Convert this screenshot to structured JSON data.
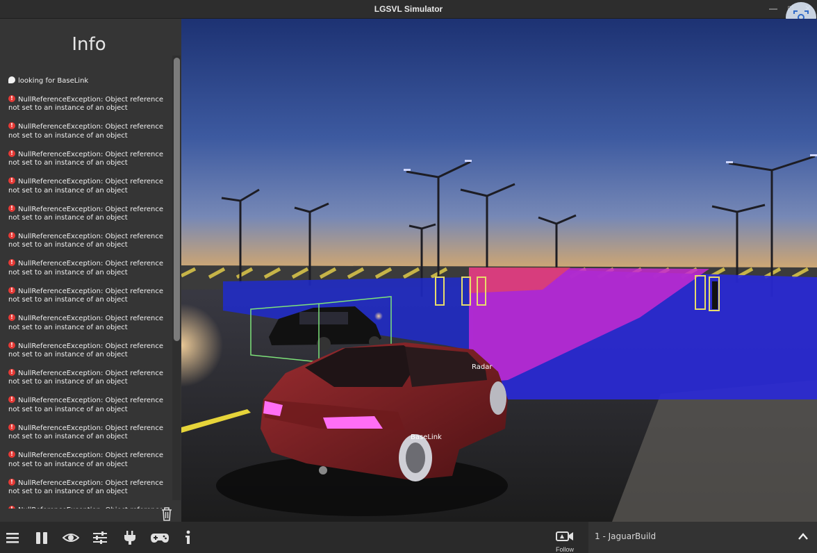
{
  "window": {
    "title": "LGSVL Simulator"
  },
  "info_panel": {
    "heading": "Info",
    "log": [
      {
        "type": "message",
        "text": "looking for BaseLink"
      },
      {
        "type": "error",
        "text": "NullReferenceException: Object reference not set to an instance of an object"
      },
      {
        "type": "error",
        "text": "NullReferenceException: Object reference not set to an instance of an object"
      },
      {
        "type": "error",
        "text": "NullReferenceException: Object reference not set to an instance of an object"
      },
      {
        "type": "error",
        "text": "NullReferenceException: Object reference not set to an instance of an object"
      },
      {
        "type": "error",
        "text": "NullReferenceException: Object reference not set to an instance of an object"
      },
      {
        "type": "error",
        "text": "NullReferenceException: Object reference not set to an instance of an object"
      },
      {
        "type": "error",
        "text": "NullReferenceException: Object reference not set to an instance of an object"
      },
      {
        "type": "error",
        "text": "NullReferenceException: Object reference not set to an instance of an object"
      },
      {
        "type": "error",
        "text": "NullReferenceException: Object reference not set to an instance of an object"
      },
      {
        "type": "error",
        "text": "NullReferenceException: Object reference not set to an instance of an object"
      },
      {
        "type": "error",
        "text": "NullReferenceException: Object reference not set to an instance of an object"
      },
      {
        "type": "error",
        "text": "NullReferenceException: Object reference not set to an instance of an object"
      },
      {
        "type": "error",
        "text": "NullReferenceException: Object reference not set to an instance of an object"
      },
      {
        "type": "error",
        "text": "NullReferenceException: Object reference not set to an instance of an object"
      },
      {
        "type": "error",
        "text": "NullReferenceException: Object reference not set to an instance of an object"
      },
      {
        "type": "error",
        "text": "NullReferenceException: Object reference not set to an instance of an object"
      }
    ]
  },
  "scene": {
    "labels": {
      "radar": "Radar",
      "baselink": "BaseLink"
    }
  },
  "toolbar": {
    "icons": [
      "menu-icon",
      "pause-icon",
      "visibility-icon",
      "settings-sliders-icon",
      "plug-icon",
      "gamepad-icon",
      "info-icon"
    ],
    "camera_label": "Follow",
    "vehicle": "1 - JaguarBuild"
  },
  "colors": {
    "sidebar_bg": "#353535",
    "error": "#e53935",
    "ego_car": "#7a1f22",
    "tail_lights": "#ff6ef5",
    "bbox": "#7ee37a"
  }
}
